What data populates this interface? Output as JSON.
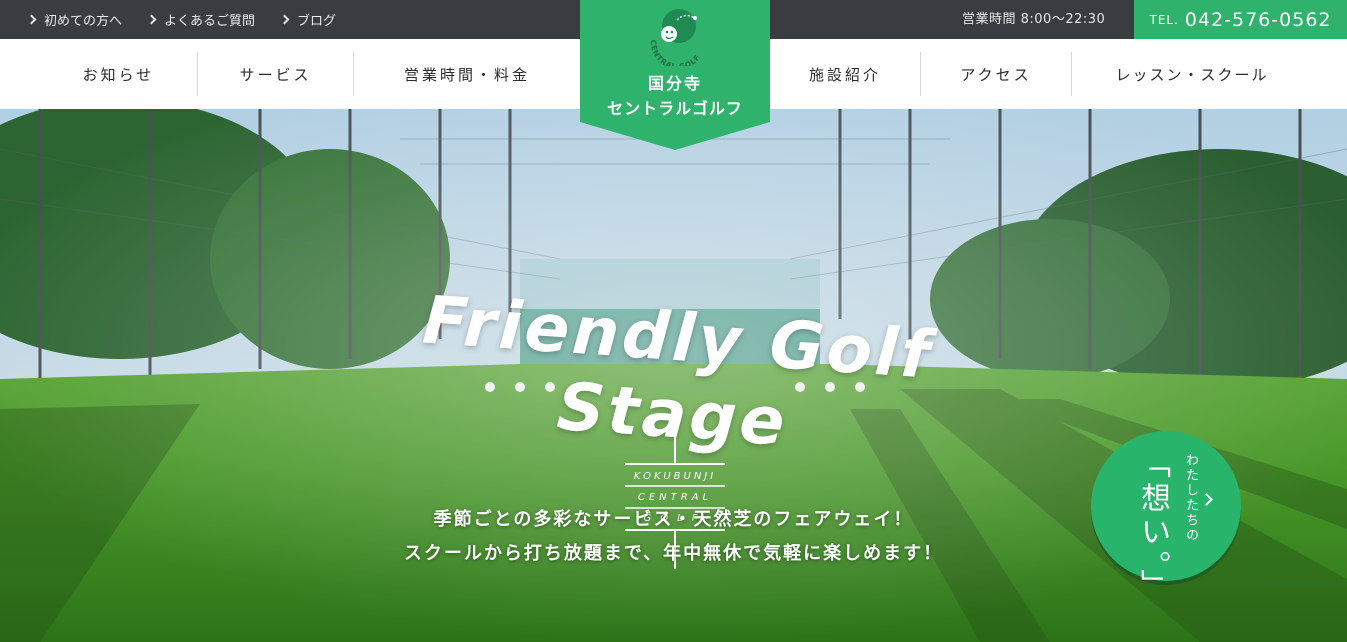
{
  "topbar": {
    "links": [
      {
        "label": "初めての方へ"
      },
      {
        "label": "よくあるご質問"
      },
      {
        "label": "ブログ"
      }
    ],
    "hours": "営業時間 8:00～22:30",
    "tel_prefix": "TEL.",
    "tel_number": "042-576-0562"
  },
  "nav": {
    "items": [
      {
        "label": "お知らせ"
      },
      {
        "label": "サービス"
      },
      {
        "label": "営業時間・料金"
      },
      {
        "label": "施設紹介"
      },
      {
        "label": "アクセス"
      },
      {
        "label": "レッスン・スクール"
      }
    ]
  },
  "logo": {
    "arc_text": "CENTRAL GOLF",
    "name_line1": "国分寺",
    "name_line2": "セントラルゴルフ"
  },
  "hero": {
    "tagline": "Friendly Golf Stage",
    "emblem": [
      "KOKUBUNJI",
      "CENTRAL",
      "GOLF"
    ],
    "copy_line1": "季節ごとの多彩なサービス・天然芝のフェアウェイ！",
    "copy_line2": "スクールから打ち放題まで、年中無休で気軽に楽しめます！"
  },
  "feature_button": {
    "small_text": "わたしたちの",
    "big_text": "「想い。」"
  },
  "colors": {
    "brand_green": "#2fb36c",
    "topbar_bg": "#393d42",
    "nav_bg": "#ffffff"
  }
}
